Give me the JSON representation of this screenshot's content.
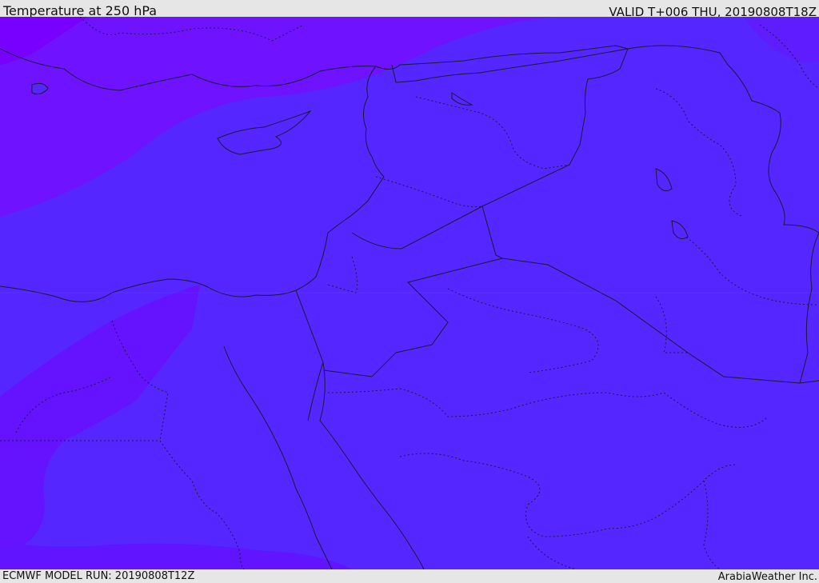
{
  "header": {
    "title": "Temperature at 250 hPa",
    "valid": "VALID T+006 THU, 20190808T18Z"
  },
  "footer": {
    "model_run": "ECMWF MODEL RUN: 20190808T12Z",
    "credit": "ArabiaWeather Inc."
  },
  "map": {
    "colors": {
      "cold_band_dark": "#7a00ff",
      "cold_band": "#6e12ff",
      "field": "#5526ff",
      "coastline": "#1a1a2e"
    }
  }
}
